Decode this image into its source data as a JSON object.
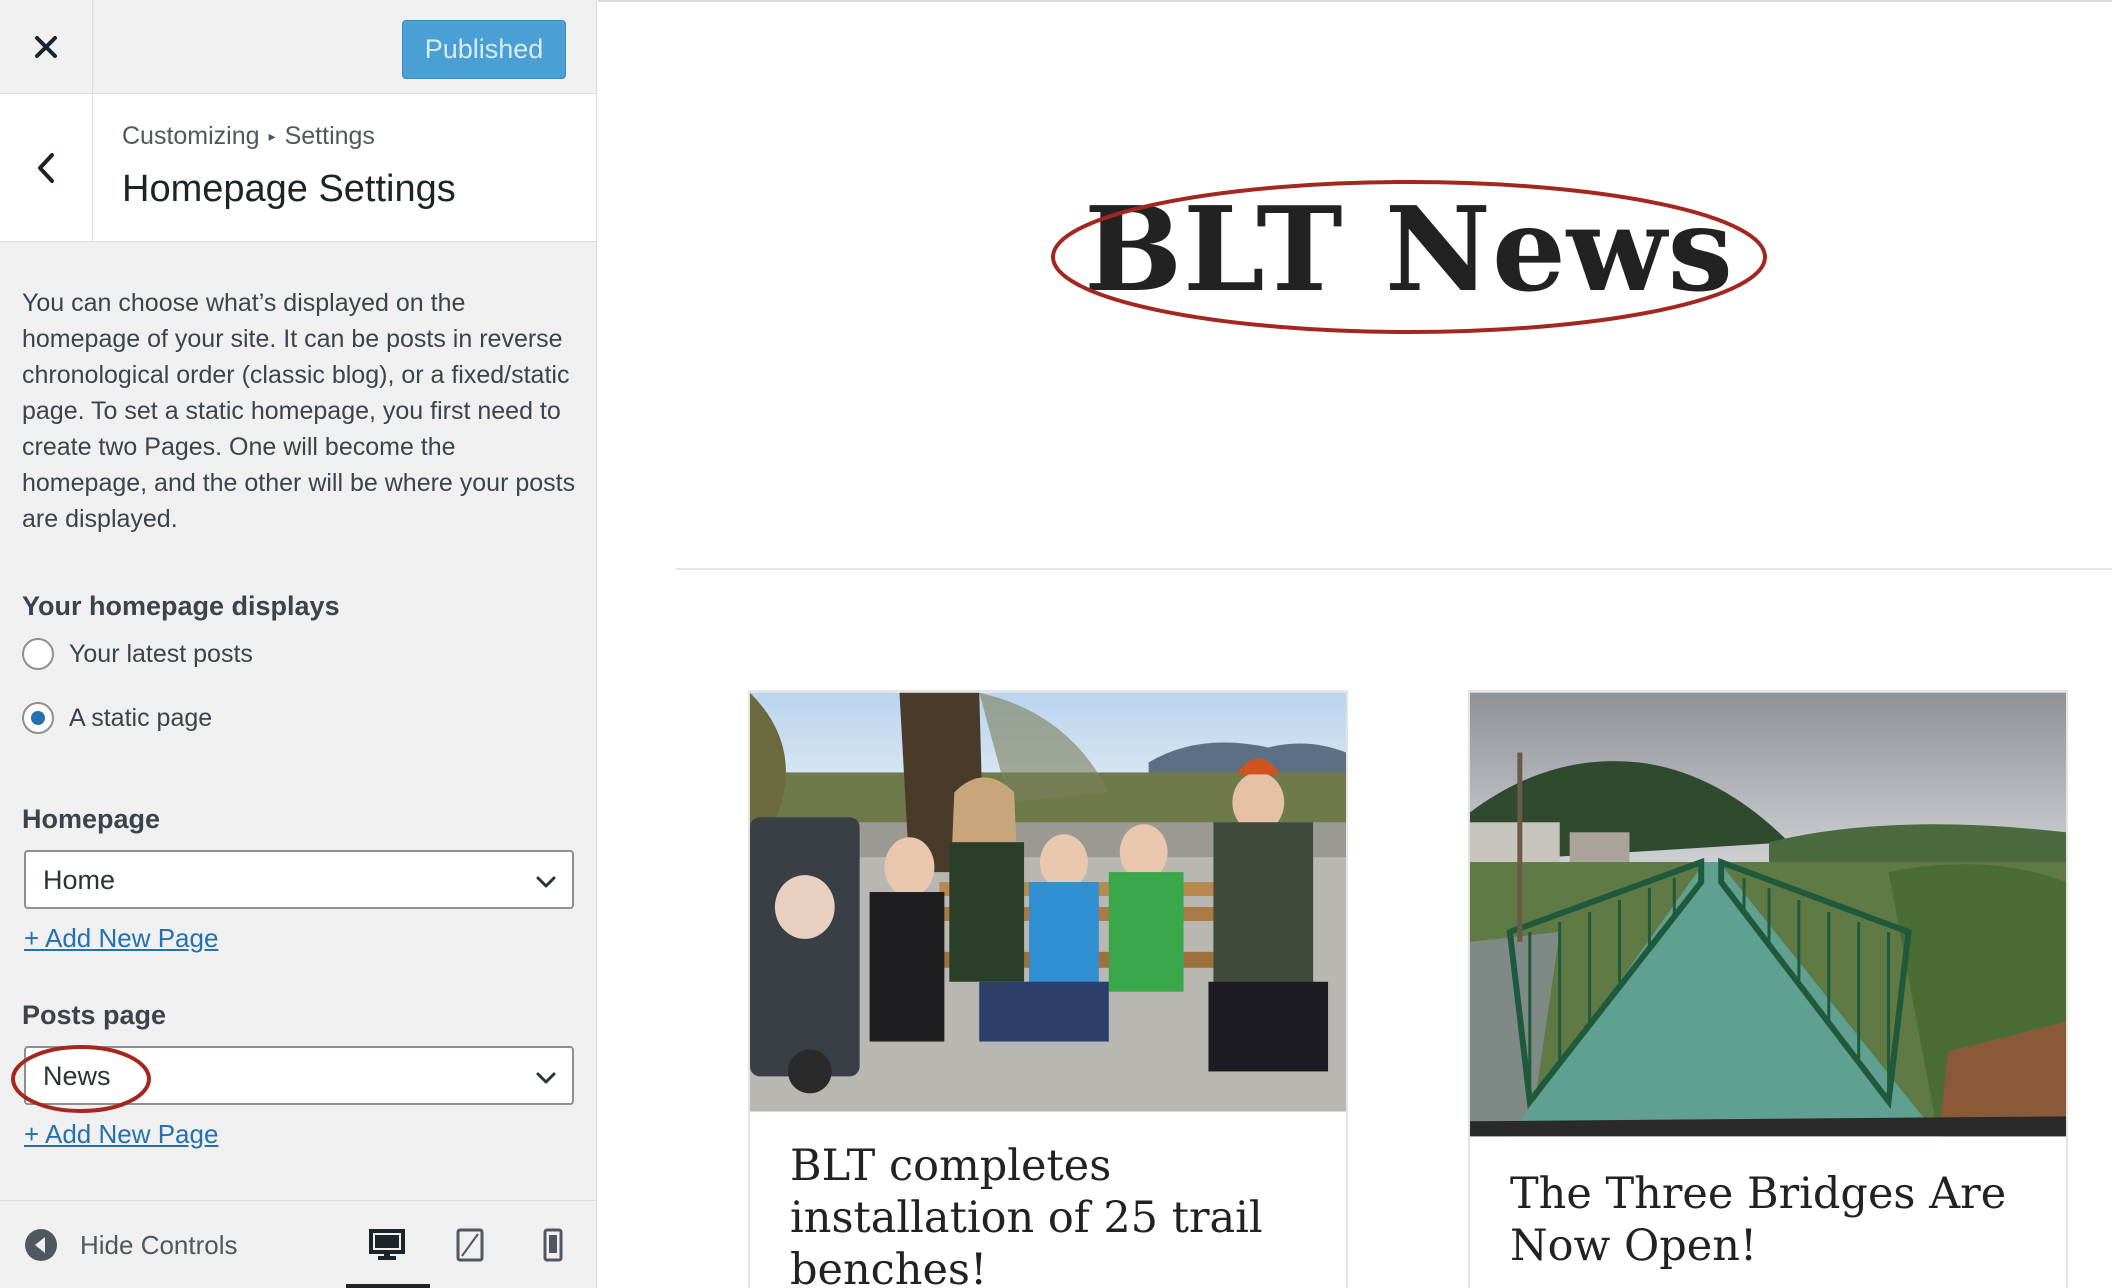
{
  "sidebar": {
    "publish_label": "Published",
    "breadcrumb": {
      "root": "Customizing",
      "separator": "▸",
      "parent": "Settings"
    },
    "section_title": "Homepage Settings",
    "description": "You can choose what’s displayed on the homepage of your site. It can be posts in reverse chronological order (classic blog), or a fixed/static page. To set a static homepage, you first need to create two Pages. One will become the homepage, and the other will be where your posts are displayed.",
    "homepage_displays": {
      "label": "Your homepage displays",
      "options": [
        {
          "label": "Your latest posts",
          "checked": false
        },
        {
          "label": "A static page",
          "checked": true
        }
      ]
    },
    "homepage": {
      "label": "Homepage",
      "selected": "Home",
      "add_link": "+ Add New Page"
    },
    "posts_page": {
      "label": "Posts page",
      "selected": "News",
      "add_link": "+ Add New Page"
    },
    "footer": {
      "hide_controls_label": "Hide Controls",
      "active_device": "desktop"
    }
  },
  "preview": {
    "site_title": "BLT News",
    "posts": [
      {
        "title": "BLT completes installation of 25 trail benches!",
        "image": "family-on-bench-photo"
      },
      {
        "title": "The Three Bridges Are Now Open!",
        "image": "green-bridge-photo"
      }
    ]
  },
  "colors": {
    "accent": "#2271b1",
    "publish_button": "#4a9fd4",
    "annotation_circle": "#a4271f"
  },
  "icons": [
    "close-icon",
    "chevron-left-icon",
    "chevron-down-icon",
    "arrow-left-circle-icon",
    "desktop-icon",
    "tablet-icon",
    "mobile-icon"
  ]
}
